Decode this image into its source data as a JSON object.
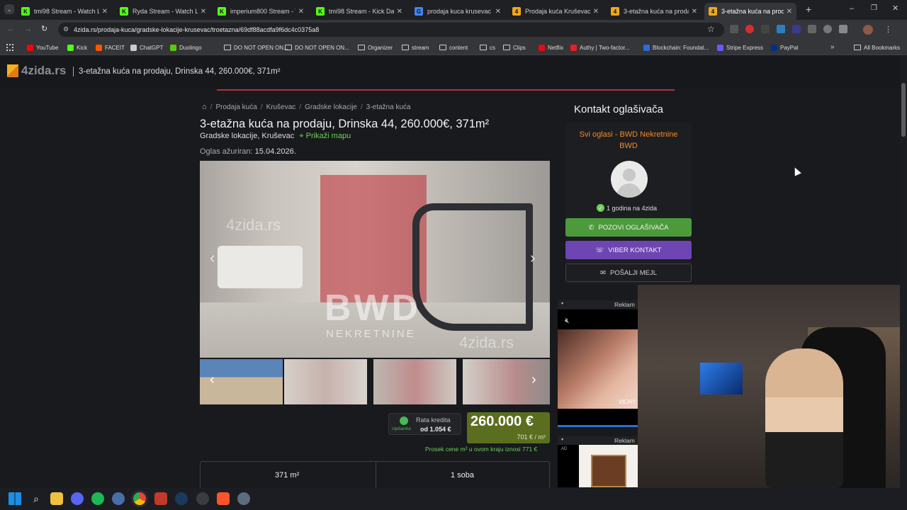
{
  "browser": {
    "tabs": [
      {
        "title": "tmi98 Stream - Watch Liv",
        "fav": "K",
        "favcolor": "#53fc18"
      },
      {
        "title": "Ryda Stream - Watch Liv",
        "fav": "K",
        "favcolor": "#53fc18"
      },
      {
        "title": "imperium800 Stream - W",
        "fav": "K",
        "favcolor": "#53fc18"
      },
      {
        "title": "tmi98 Stream - Kick Dashb",
        "fav": "K",
        "favcolor": "#53fc18"
      },
      {
        "title": "prodaja kuca krusevac - G",
        "fav": "G",
        "favcolor": "#4285f4"
      },
      {
        "title": "Prodaja kuća Kruševac - 4",
        "fav": "4",
        "favcolor": "#f0a71c"
      },
      {
        "title": "3-etažna kuća na prodaju",
        "fav": "4",
        "favcolor": "#f0a71c"
      },
      {
        "title": "3-etažna kuća na prodaju",
        "fav": "4",
        "favcolor": "#f0a71c"
      }
    ],
    "url": "4zida.rs/prodaja-kuca/gradske-lokacije-krusevac/troetazna/69df88acdfa9f6dc4c0375a8",
    "bookmarks": [
      {
        "label": "YouTube",
        "color": "#ff0000"
      },
      {
        "label": "Kick",
        "color": "#53fc18"
      },
      {
        "label": "FACEIT",
        "color": "#ff5500"
      },
      {
        "label": "ChatGPT",
        "color": "#cccccc"
      },
      {
        "label": "Duolingo",
        "color": "#58cc02"
      },
      {
        "label": "DO NOT OPEN ON...",
        "color": "folder"
      },
      {
        "label": "DO NOT OPEN ON...",
        "color": "folder"
      },
      {
        "label": "Organizer",
        "color": "folder"
      },
      {
        "label": "stream",
        "color": "folder"
      },
      {
        "label": "content",
        "color": "folder"
      },
      {
        "label": "cs",
        "color": "folder"
      },
      {
        "label": "Clips",
        "color": "folder"
      },
      {
        "label": "Netflix",
        "color": "#e50914"
      },
      {
        "label": "Authy | Two-factor...",
        "color": "#ec1c24"
      },
      {
        "label": "Blockchain: Foundat...",
        "color": "#2b6cd8"
      },
      {
        "label": "Stripe Express",
        "color": "#635bff"
      },
      {
        "label": "PayPal",
        "color": "#003087"
      }
    ],
    "all_bookmarks": "All Bookmarks"
  },
  "site": {
    "logo": "4zida.rs",
    "header_title": "3-etažna kuća na prodaju, Drinska 44, 260.000€, 371m²",
    "breadcrumb": [
      "Prodaja kuća",
      "Kruševac",
      "Gradske lokacije",
      "3-etažna kuća"
    ],
    "title": "3-etažna kuća na prodaju, Drinska 44, 260.000€, 371m²",
    "location": "Gradske lokacije, Kruševac",
    "map_link": "Prikaži mapu",
    "updated_label": "Oglas ažuriran:",
    "updated_date": "15.04.2026.",
    "watermark_brand": "BWD",
    "watermark_sub": "NEKRETNINE",
    "watermark_site": "4zida.rs",
    "loan_label": "Rata kredita",
    "loan_value": "od 1.054 €",
    "bank": "otpbanka",
    "price": "260.000 €",
    "price_per_m2": "701 € / m²",
    "avg_note": "Prosek cene m² u ovom kraju iznosi 771 €",
    "features": [
      "371 m²",
      "1 soba"
    ]
  },
  "contact": {
    "heading": "Kontakt oglašivača",
    "agency_link": "Svi oglasi - BWD Nekretnine BWD",
    "member_since": "1 godina na 4zida",
    "call_button": "POZOVI OGLAŠIVAČA",
    "viber_button": "VIBER KONTAKT",
    "mail_button": "POŠALJI MEJL",
    "ad_label": "Reklam",
    "ad_brand": "VICHY",
    "ad2_label": "Reklam",
    "ad2_tag": "AD"
  }
}
